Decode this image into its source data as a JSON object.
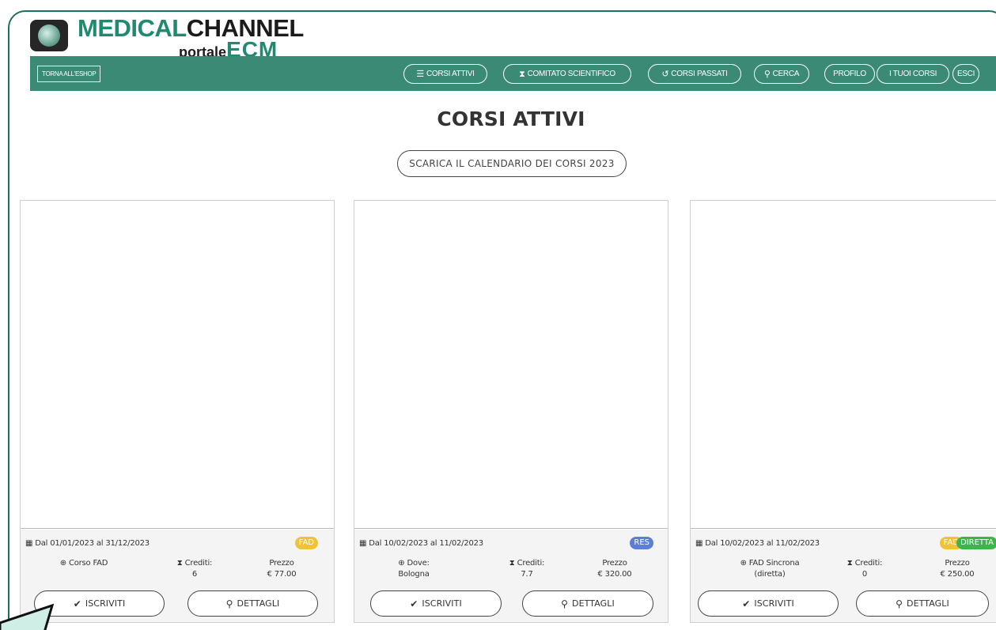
{
  "brand": {
    "line1_medical": "MEDICAL",
    "line1_channel": "CHANNEL",
    "line2_portale": "portale",
    "line2_ecm": "ECM"
  },
  "nav": {
    "shop": "TORNA ALL'ESHOP",
    "items": [
      {
        "label": "CORSI ATTIVI",
        "icon": "list-icon"
      },
      {
        "label": "COMITATO SCIENTIFICO",
        "icon": "user-doctor-icon"
      },
      {
        "label": "CORSI PASSATI",
        "icon": "history-icon"
      },
      {
        "label": "CERCA",
        "icon": "search-icon"
      },
      {
        "label": "PROFILO"
      },
      {
        "label": "I TUOI CORSI"
      },
      {
        "label": "ESCI"
      }
    ]
  },
  "page": {
    "title": "CORSI ATTIVI",
    "calendar_button": "SCARICA IL CALENDARIO DEI CORSI 2023"
  },
  "cards": [
    {
      "dates": "Dal 01/01/2023 al 31/12/2023",
      "badges": [
        "FAD"
      ],
      "type_line1": "Corso FAD",
      "type_line2": "",
      "credits_label": "Crediti:",
      "credits": "6",
      "price_label": "Prezzo",
      "price": "€ 77.00",
      "enroll": "ISCRIVITI",
      "details": "DETTAGLI"
    },
    {
      "dates": "Dal 10/02/2023 al 11/02/2023",
      "badges": [
        "RES"
      ],
      "type_line1": "Dove:",
      "type_line2": "Bologna",
      "credits_label": "Crediti:",
      "credits": "7.7",
      "price_label": "Prezzo",
      "price": "€ 320.00",
      "enroll": "ISCRIVITI",
      "details": "DETTAGLI"
    },
    {
      "dates": "Dal 10/02/2023 al 11/02/2023",
      "badges": [
        "FAD",
        "DIRETTA"
      ],
      "type_line1": "FAD Sincrona",
      "type_line2": "(diretta)",
      "credits_label": "Crediti:",
      "credits": "0",
      "price_label": "Prezzo",
      "price": "€ 250.00",
      "enroll": "ISCRIVITI",
      "details": "DETTAGLI"
    }
  ],
  "colors": {
    "nav_bg": "#3a8a76",
    "brand_green": "#1f8a70",
    "badge_fad": "#f1c232",
    "badge_res": "#5b7fd6",
    "badge_diretta": "#3cb54a"
  }
}
